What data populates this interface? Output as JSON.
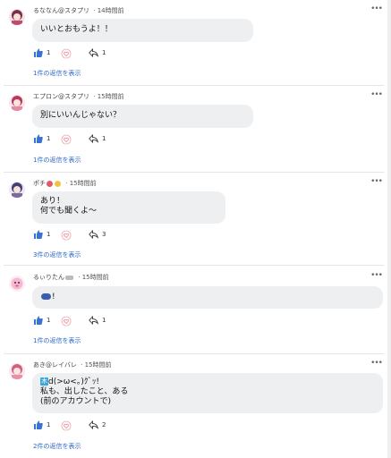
{
  "comments": [
    {
      "user": "るななん@スタプリ",
      "time": "14時間前",
      "lines": [
        "いいとおもうよ！！"
      ],
      "likes": "1",
      "shares": "1",
      "replies": "1件の返信を表示",
      "avatar_color": "#8a3a52"
    },
    {
      "user": "エプロン@スタプリ",
      "time": "15時間前",
      "lines": [
        "別にいいんじゃない？"
      ],
      "likes": "1",
      "shares": "1",
      "replies": "1件の返信を表示",
      "avatar_color": "#c2456a"
    },
    {
      "user": "ポチ",
      "time": "15時間前",
      "lines": [
        "あり！",
        "何でも聞くよ〜"
      ],
      "likes": "1",
      "shares": "3",
      "replies": "3件の返信を表示",
      "avatar_color": "#5a4a7a"
    },
    {
      "user": "るぃりたん",
      "time": "15時間前",
      "lines": [
        "!"
      ],
      "likes": "1",
      "shares": "1",
      "replies": "1件の返信を表示",
      "avatar_color": "#e07aa8"
    },
    {
      "user": "あき@レイバレ",
      "time": "15時間前",
      "lines": [
        "d(>ω<。)ｸﾞｯ!",
        "私も、出したこと、ある",
        "(前のアカウントで)"
      ],
      "line1_tag": "木",
      "likes": "1",
      "shares": "2",
      "replies": "2件の返信を表示",
      "avatar_color": "#d07a94"
    }
  ],
  "more_label": "•••",
  "colors": {
    "link": "#2a67c9",
    "like": "#3a73d6",
    "bubble": "#eeeff1"
  },
  "icons": [
    "thumbs-up-icon",
    "heart-flower-icon",
    "share-arrow-icon",
    "more-icon"
  ]
}
